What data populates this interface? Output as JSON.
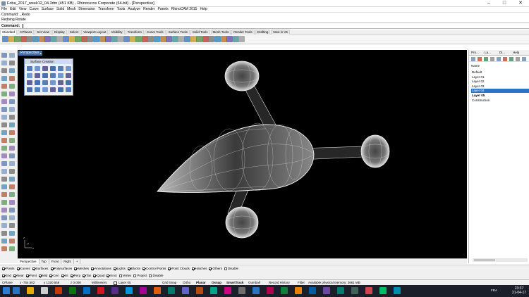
{
  "window": {
    "title": "Foba_2017_week12_04.3dm (451 KB) - Rhinoceros Corporate (64-bit) - [Perspective]",
    "min_glyph": "–",
    "max_glyph": "□",
    "close_glyph": "✕"
  },
  "menu": [
    "File",
    "Edit",
    "View",
    "Curve",
    "Surface",
    "Solid",
    "Mesh",
    "Dimension",
    "Transform",
    "Tools",
    "Analyze",
    "Render",
    "Panels",
    "RhinoCAM 2015",
    "Help"
  ],
  "command": {
    "history": [
      "Command: _Redo",
      "Redoing Rotate"
    ],
    "prompt": "Command:"
  },
  "toolbar_tabs": [
    "Standard",
    "CPlanes",
    "Set View",
    "Display",
    "Select",
    "Viewport Layout",
    "Visibility",
    "Transform",
    "Curve Tools",
    "Surface Tools",
    "Solid Tools",
    "Mesh Tools",
    "Render Tools",
    "Drafting",
    "New in V5"
  ],
  "viewport": {
    "label": "Perspective",
    "axis_x": "x",
    "axis_y": "y",
    "axis_z": "z"
  },
  "surface_panel": {
    "title": "Surface Creation"
  },
  "viewport_tabs": [
    "Perspective",
    "Top",
    "Front",
    "Right",
    "+"
  ],
  "right_panel": {
    "tabs": [
      "Pro...",
      "La...",
      "Di...",
      "Help"
    ],
    "header": "Name",
    "layers": [
      {
        "name": "Default",
        "selected": false,
        "bold": false
      },
      {
        "name": "Layer 01",
        "selected": false,
        "bold": false
      },
      {
        "name": "Layer 02",
        "selected": false,
        "bold": false
      },
      {
        "name": "Layer 03",
        "selected": false,
        "bold": false
      },
      {
        "name": "Layer 04",
        "selected": true,
        "bold": false
      },
      {
        "name": "Layer 05",
        "selected": false,
        "bold": true
      },
      {
        "name": "Construction",
        "selected": false,
        "bold": false
      }
    ]
  },
  "filters": [
    {
      "label": "Points",
      "on": true
    },
    {
      "label": "Curves",
      "on": true
    },
    {
      "label": "Surfaces",
      "on": true
    },
    {
      "label": "Polysurfaces",
      "on": true
    },
    {
      "label": "Meshes",
      "on": true
    },
    {
      "label": "Annotations",
      "on": true
    },
    {
      "label": "Lights",
      "on": true
    },
    {
      "label": "Blocks",
      "on": true
    },
    {
      "label": "Control Points",
      "on": true
    },
    {
      "label": "Point Clouds",
      "on": true
    },
    {
      "label": "Hatches",
      "on": true
    },
    {
      "label": "Others",
      "on": true
    },
    {
      "label": "Disable",
      "on": false
    }
  ],
  "osnaps": [
    {
      "label": "End",
      "on": true
    },
    {
      "label": "Near",
      "on": true
    },
    {
      "label": "Point",
      "on": true
    },
    {
      "label": "Mid",
      "on": true
    },
    {
      "label": "Cen",
      "on": true
    },
    {
      "label": "Int",
      "on": true
    },
    {
      "label": "Perp",
      "on": true
    },
    {
      "label": "Tan",
      "on": true
    },
    {
      "label": "Quad",
      "on": true
    },
    {
      "label": "Knot",
      "on": true
    },
    {
      "label": "Vertex",
      "on": false
    },
    {
      "label": "Project",
      "on": false
    },
    {
      "label": "Disable",
      "on": false
    }
  ],
  "status": {
    "cplane": "CPlane",
    "x": "x -754.502",
    "y": "y 1320.559",
    "z": "z 0.000",
    "units": "Millimeters",
    "layer": "Layer 05",
    "grid_snap": "Grid Snap",
    "ortho": "Ortho",
    "planar": "Planar",
    "osnap": "Osnap",
    "smarttrack": "SmartTrack",
    "gumball": "Gumball",
    "record_history": "Record History",
    "filter": "Filter",
    "memory": "Available physical memory: 2661 MB"
  },
  "taskbar": {
    "time": "23:37",
    "date": "21-04-17",
    "lang": "FRA"
  },
  "colors": {
    "selection": "#2f73c9",
    "viewport_bg": "#000000",
    "taskbar": "#1b1f2a"
  }
}
